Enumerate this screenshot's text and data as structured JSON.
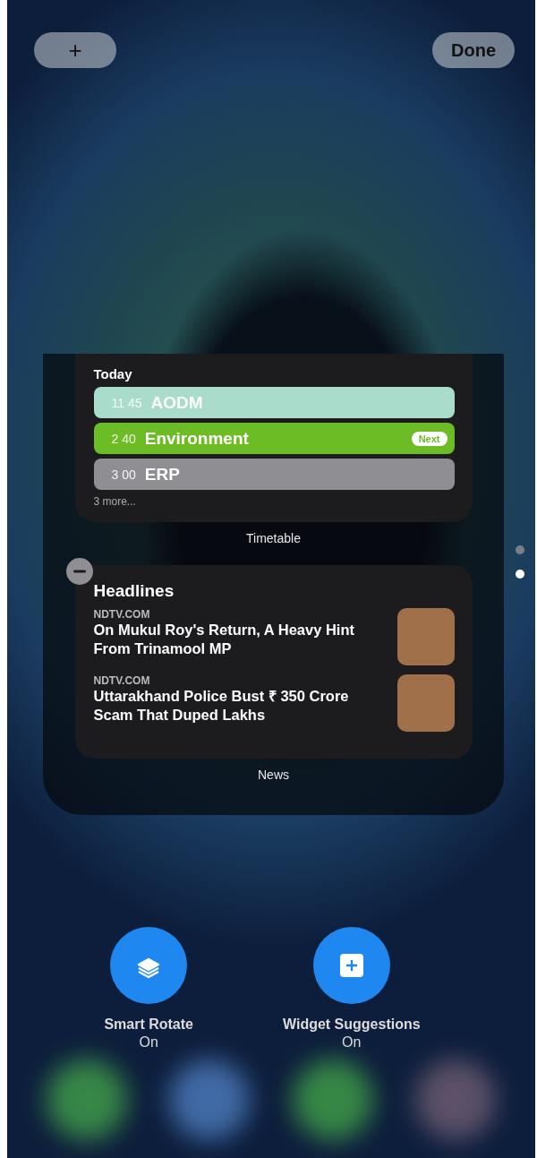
{
  "top_bar": {
    "add_button": "+",
    "done_button": "Done"
  },
  "timetable_widget": {
    "heading": "Today",
    "events": [
      {
        "time": "11 45",
        "title": "AODM",
        "color": "#a9dccb"
      },
      {
        "time": "2 40",
        "title": "Environment",
        "color": "#6cbd25",
        "badge": "Next"
      },
      {
        "time": "3 00",
        "title": "ERP",
        "color": "#8e8e93"
      }
    ],
    "more": "3 more...",
    "label": "Timetable"
  },
  "news_widget": {
    "heading": "Headlines",
    "removable": true,
    "articles": [
      {
        "source": "NDTV.COM",
        "headline": "On Mukul Roy's Return, A Heavy Hint From Trinamool MP"
      },
      {
        "source": "NDTV.COM",
        "headline": "Uttarakhand Police Bust ₹ 350 Crore Scam That Duped Lakhs"
      }
    ],
    "label": "News"
  },
  "page_dots": [
    {
      "selected": false
    },
    {
      "selected": true
    }
  ],
  "settings": [
    {
      "kind": "stack",
      "title": "Smart Rotate",
      "value": "On"
    },
    {
      "kind": "add",
      "title": "Widget Suggestions",
      "value": "On"
    }
  ]
}
